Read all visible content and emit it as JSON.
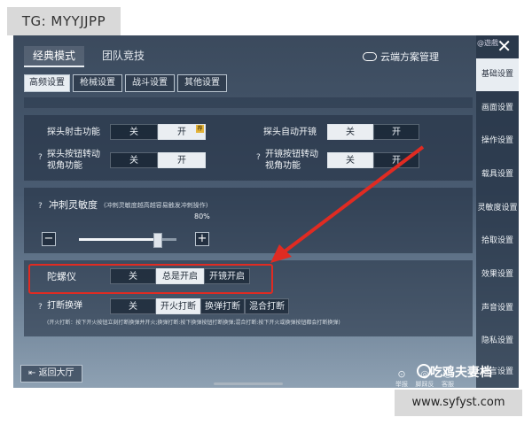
{
  "watermark_top": "TG: MYYJJPP",
  "watermark_bottom": "www.syfyst.com",
  "overlay_mark": "吃鸡夫妻档",
  "tabs": {
    "classic": "经典模式",
    "team": "团队竞技"
  },
  "cloud_label": "云端方案管理",
  "subtabs": [
    "高频设置",
    "枪械设置",
    "战斗设置",
    "其他设置"
  ],
  "rows": {
    "peek_fire": {
      "label": "探头射击功能",
      "off": "关",
      "on": "开",
      "selected": "on",
      "badge": "荐"
    },
    "peek_scope": {
      "label": "探头自动开镜",
      "off": "关",
      "on": "开",
      "selected": "off"
    },
    "peek_btn_view": {
      "label": "探头按钮转动视角功能",
      "off": "关",
      "on": "开",
      "selected": "on"
    },
    "scope_btn_view": {
      "label": "开镜按钮转动视角功能",
      "off": "关",
      "on": "开",
      "selected": "off"
    }
  },
  "sprint": {
    "label": "冲刺灵敏度",
    "note": "(冲刺灵敏度越高越容易触发冲刺操作)",
    "value": "80%",
    "minus": "−",
    "plus": "+"
  },
  "gyro": {
    "label": "陀螺仪",
    "options": [
      "关",
      "总是开启",
      "开镜开启"
    ],
    "selected": 1
  },
  "reload_interrupt": {
    "label": "打断换弹",
    "options": [
      "关",
      "开火打断",
      "换弹打断",
      "混合打断"
    ],
    "selected": 1,
    "note": "(开火打断：按下开火按钮立刻打断换弹并开火;换弹打断:按下换弹按钮打断换弹;混合打断:按下开火或换弹按钮都会打断换弹)"
  },
  "back_label": "返回大厅",
  "sidebar": [
    "基础设置",
    "画面设置",
    "操作设置",
    "载具设置",
    "灵敏度设置",
    "拾取设置",
    "效果设置",
    "声音设置",
    "隐私设置",
    "语言设置"
  ],
  "sidebar_active": 0,
  "corner_chip": "@遊戲",
  "close": "✕",
  "bottom_icons": [
    "举报",
    "脚踩反馈",
    "客服"
  ],
  "colors": {
    "highlight": "#e02b22",
    "selected": "#eaeef2"
  }
}
